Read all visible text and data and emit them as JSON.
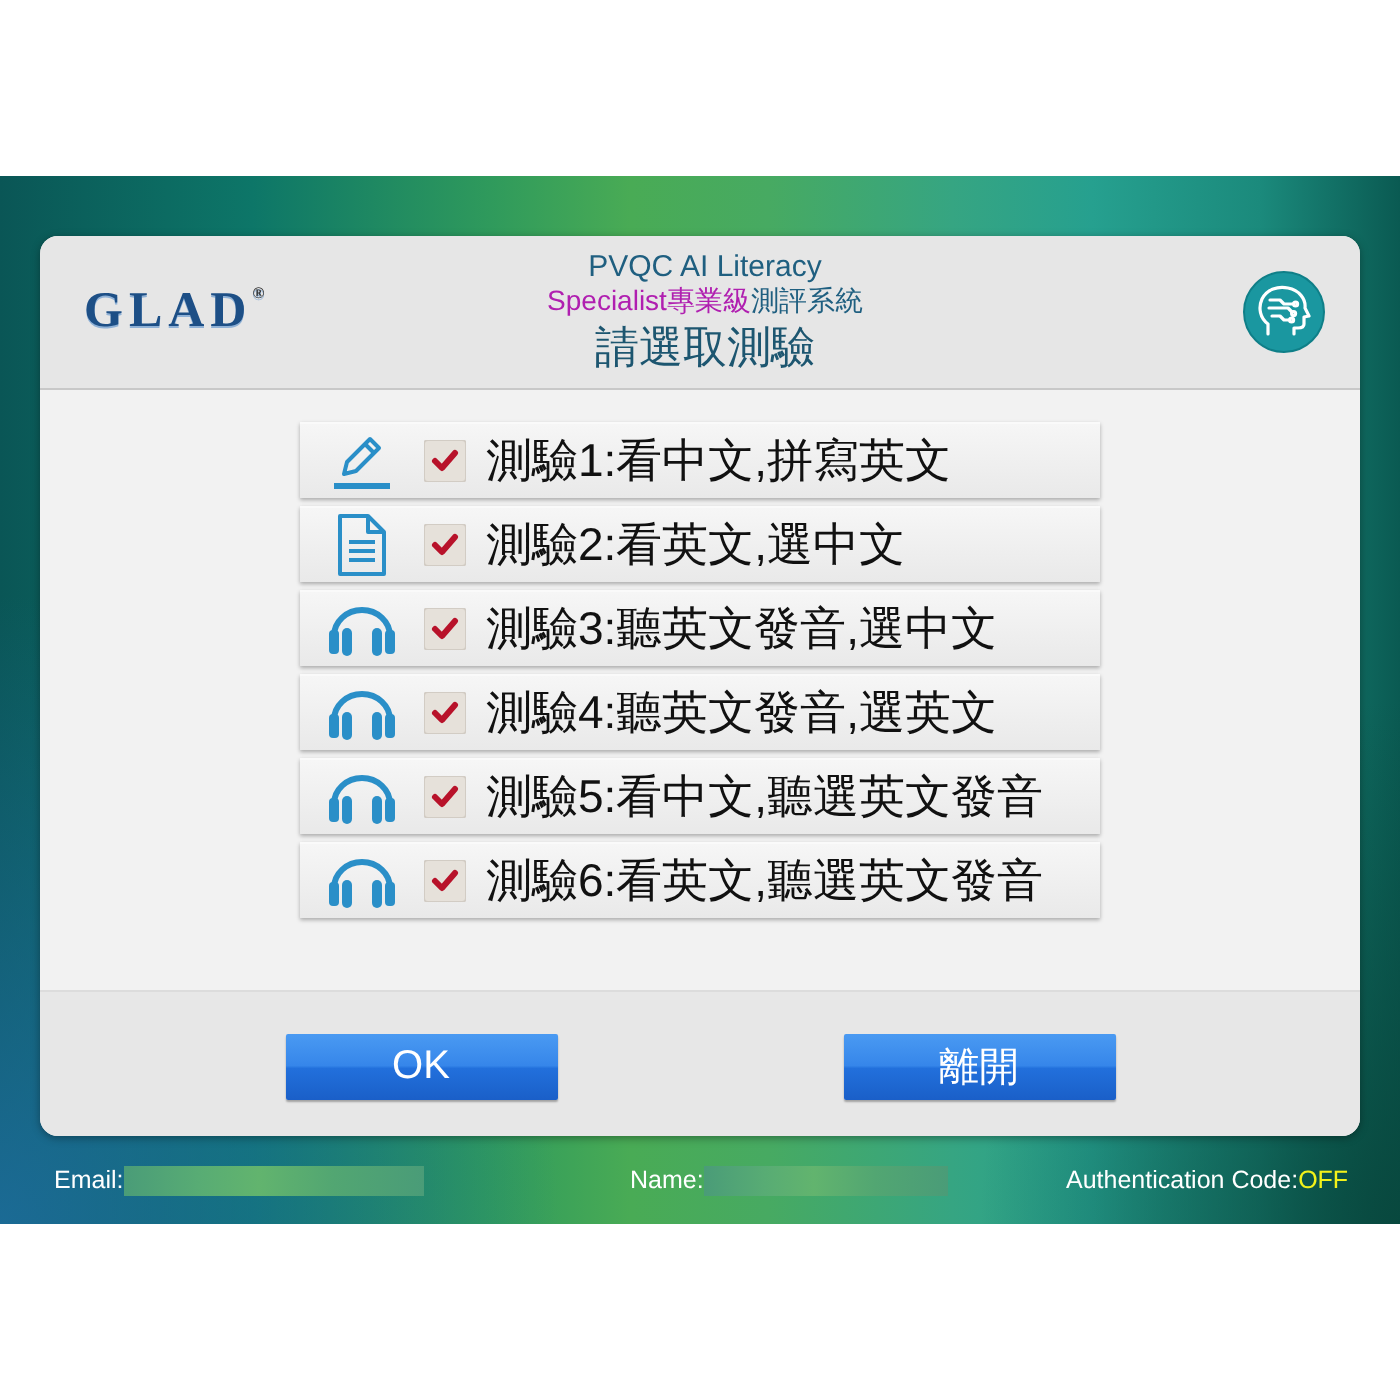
{
  "header": {
    "logo": "GLAD$^{®}$",
    "title": "PVQC AI Literacy",
    "subtitle": {
      "highlight": "Specialist專業級",
      "rest": "測評系統"
    },
    "heading": "請選取測驗"
  },
  "tests": [
    {
      "kind": "pencil",
      "label": "測驗1:看中文,拼寫英文",
      "checked": true
    },
    {
      "kind": "document",
      "label": "測驗2:看英文,選中文",
      "checked": true
    },
    {
      "kind": "headphones",
      "label": "測驗3:聽英文發音,選中文",
      "checked": true
    },
    {
      "kind": "headphones",
      "label": "測驗4:聽英文發音,選英文",
      "checked": true
    },
    {
      "kind": "headphones",
      "label": "測驗5:看中文,聽選英文發音",
      "checked": true
    },
    {
      "kind": "headphones",
      "label": "測驗6:看英文,聽選英文發音",
      "checked": true
    }
  ],
  "buttons": [
    "OK",
    "離開"
  ],
  "status_bar": {
    "email_label": "Email:",
    "name_label": "Name:",
    "auth_label": "Authentication Code:",
    "auth_value": "OFF"
  }
}
